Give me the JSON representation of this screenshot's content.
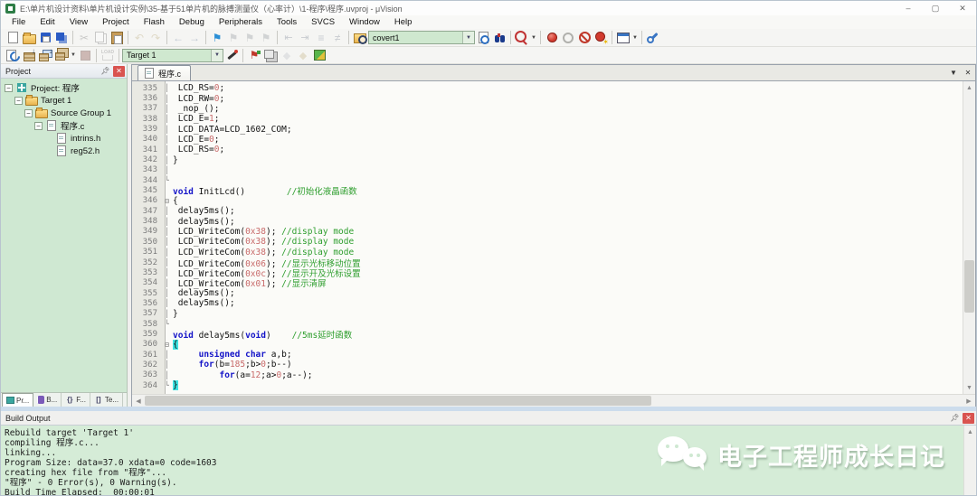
{
  "window": {
    "title": "E:\\单片机设计资料\\单片机设计实例\\35-基于51单片机的脉搏测量仪（心率计）\\1-程序\\程序.uvproj - μVision",
    "controls": [
      {
        "name": "minimize",
        "glyph": "–"
      },
      {
        "name": "maximize",
        "glyph": "▢"
      },
      {
        "name": "close",
        "glyph": "✕"
      }
    ]
  },
  "menu": {
    "items": [
      "File",
      "Edit",
      "View",
      "Project",
      "Flash",
      "Debug",
      "Peripherals",
      "Tools",
      "SVCS",
      "Window",
      "Help"
    ]
  },
  "toolbar1": {
    "search_value": "covert1",
    "icons": [
      {
        "t": "i",
        "n": "new-file-icon",
        "c": "i-page"
      },
      {
        "t": "i",
        "n": "open-file-icon",
        "c": "i-folder"
      },
      {
        "t": "i",
        "n": "save-icon",
        "c": "i-save"
      },
      {
        "t": "i",
        "n": "save-all-icon",
        "c": "i-saveall"
      },
      {
        "t": "s"
      },
      {
        "t": "i",
        "n": "cut-icon",
        "c": "i-cut",
        "g": 1
      },
      {
        "t": "i",
        "n": "copy-icon",
        "c": "i-copy",
        "g": 1
      },
      {
        "t": "i",
        "n": "paste-icon",
        "c": "i-paste"
      },
      {
        "t": "s"
      },
      {
        "t": "i",
        "n": "undo-icon",
        "c": "i-undo",
        "g": 1
      },
      {
        "t": "i",
        "n": "redo-icon",
        "c": "i-redo",
        "g": 1
      },
      {
        "t": "s"
      },
      {
        "t": "i",
        "n": "navigate-back-icon",
        "c": "i-back",
        "g": 1
      },
      {
        "t": "i",
        "n": "navigate-forward-icon",
        "c": "i-fwd",
        "g": 1
      },
      {
        "t": "s"
      },
      {
        "t": "i",
        "n": "bookmark-toggle-icon",
        "c": "i-flag"
      },
      {
        "t": "i",
        "n": "bookmark-prev-icon",
        "c": "i-flagg",
        "g": 1
      },
      {
        "t": "i",
        "n": "bookmark-next-icon",
        "c": "i-flagg",
        "g": 1
      },
      {
        "t": "i",
        "n": "bookmark-clear-icon",
        "c": "i-flagg",
        "g": 1
      },
      {
        "t": "s"
      },
      {
        "t": "i",
        "n": "unindent-icon",
        "c": "i-unind",
        "g": 1
      },
      {
        "t": "i",
        "n": "indent-icon",
        "c": "i-ind",
        "g": 1
      },
      {
        "t": "i",
        "n": "comment-icon",
        "c": "i-cmt",
        "g": 1
      },
      {
        "t": "i",
        "n": "uncomment-icon",
        "c": "i-ucmt",
        "g": 1
      },
      {
        "t": "s"
      },
      {
        "t": "i",
        "n": "find-in-files-icon",
        "c": "i-fif"
      },
      {
        "t": "combo",
        "n": "search-combobox",
        "bind": "toolbar1.search_value",
        "w": 118
      },
      {
        "t": "i",
        "n": "lookup-icon",
        "c": "i-lookup"
      },
      {
        "t": "i",
        "n": "find-icon",
        "c": "i-bino"
      },
      {
        "t": "s"
      },
      {
        "t": "i",
        "n": "run-to-cursor-icon",
        "c": "i-mag"
      },
      {
        "t": "caret"
      },
      {
        "t": "s"
      },
      {
        "t": "i",
        "n": "breakpoint-toggle-icon",
        "c": "i-dot"
      },
      {
        "t": "i",
        "n": "breakpoint-enable-icon",
        "c": "i-doto"
      },
      {
        "t": "i",
        "n": "breakpoint-disable-icon",
        "c": "i-dis"
      },
      {
        "t": "i",
        "n": "breakpoint-kill-all-icon",
        "c": "i-kill"
      },
      {
        "t": "s"
      },
      {
        "t": "i",
        "n": "debug-windows-icon",
        "c": "i-win"
      },
      {
        "t": "caret"
      },
      {
        "t": "s"
      },
      {
        "t": "i",
        "n": "configure-tools-icon",
        "c": "i-wrench"
      }
    ]
  },
  "toolbar2": {
    "target_value": "Target 1",
    "icons": [
      {
        "t": "i",
        "n": "translate-icon",
        "c": "i-trans"
      },
      {
        "t": "i",
        "n": "build-icon",
        "c": "i-build"
      },
      {
        "t": "i",
        "n": "rebuild-icon",
        "c": "i-rebuild"
      },
      {
        "t": "i",
        "n": "batch-build-icon",
        "c": "i-batch"
      },
      {
        "t": "caret"
      },
      {
        "t": "i",
        "n": "stop-build-icon",
        "c": "i-stop",
        "g": 1
      },
      {
        "t": "s"
      },
      {
        "t": "i",
        "n": "download-icon",
        "c": "i-load",
        "g": 1
      },
      {
        "t": "s"
      },
      {
        "t": "combo",
        "n": "target-combobox",
        "bind": "toolbar2.target_value",
        "w": 112
      },
      {
        "t": "i",
        "n": "options-for-target-icon",
        "c": "i-wand"
      },
      {
        "t": "s"
      },
      {
        "t": "i",
        "n": "file-extensions-icon",
        "c": "i-flag2"
      },
      {
        "t": "i",
        "n": "manage-project-items-icon",
        "c": "i-layers"
      },
      {
        "t": "i",
        "n": "multi-project-icon",
        "c": "i-diam",
        "g": 1
      },
      {
        "t": "i",
        "n": "project-workspace-icon",
        "c": "i-diam2",
        "g": 1
      },
      {
        "t": "i",
        "n": "manage-books-icon",
        "c": "i-pkg"
      }
    ]
  },
  "project_panel": {
    "title": "Project",
    "tree": [
      {
        "label": "Project: 程序",
        "depth": 0,
        "icon": "t-proj",
        "exp": "−"
      },
      {
        "label": "Target 1",
        "depth": 1,
        "icon": "t-folder",
        "exp": "−"
      },
      {
        "label": "Source Group 1",
        "depth": 2,
        "icon": "t-folder",
        "exp": "−"
      },
      {
        "label": "程序.c",
        "depth": 3,
        "icon": "t-file",
        "exp": "−"
      },
      {
        "label": "intrins.h",
        "depth": 4,
        "icon": "t-file",
        "exp": ""
      },
      {
        "label": "reg52.h",
        "depth": 4,
        "icon": "t-file",
        "exp": ""
      }
    ],
    "tabs": [
      {
        "label": "Pr...",
        "icon": "pt-proj",
        "glyph": "",
        "active": true
      },
      {
        "label": "B...",
        "icon": "pt-book",
        "glyph": "",
        "active": false
      },
      {
        "label": "F...",
        "icon": "pt-func",
        "glyph": "{}",
        "active": false
      },
      {
        "label": "Te...",
        "icon": "pt-tmpl",
        "glyph": "[]",
        "active": false
      }
    ]
  },
  "editor": {
    "tab": "程序.c",
    "tab_buttons": [
      {
        "name": "tab-list-dropdown",
        "glyph": "▼"
      },
      {
        "name": "close-document",
        "glyph": "✕"
      }
    ],
    "code": {
      "lines": [
        {
          "n": 335,
          "f": "m",
          "s": [
            [
              "p",
              " LCD_RS="
            ],
            [
              "n",
              "0"
            ],
            [
              "p",
              ";"
            ]
          ]
        },
        {
          "n": 336,
          "f": "m",
          "s": [
            [
              "p",
              " LCD_RW="
            ],
            [
              "n",
              "0"
            ],
            [
              "p",
              ";"
            ]
          ]
        },
        {
          "n": 337,
          "f": "m",
          "s": [
            [
              "p",
              " _nop_();"
            ]
          ]
        },
        {
          "n": 338,
          "f": "m",
          "s": [
            [
              "p",
              " LCD_E="
            ],
            [
              "n",
              "1"
            ],
            [
              "p",
              ";"
            ]
          ]
        },
        {
          "n": 339,
          "f": "m",
          "s": [
            [
              "p",
              " LCD_DATA=LCD_1602_COM;"
            ]
          ]
        },
        {
          "n": 340,
          "f": "m",
          "s": [
            [
              "p",
              " LCD_E="
            ],
            [
              "n",
              "0"
            ],
            [
              "p",
              ";"
            ]
          ]
        },
        {
          "n": 341,
          "f": "m",
          "s": [
            [
              "p",
              " LCD_RS="
            ],
            [
              "n",
              "0"
            ],
            [
              "p",
              ";"
            ]
          ]
        },
        {
          "n": 342,
          "f": "m",
          "s": [
            [
              "p",
              "}"
            ]
          ]
        },
        {
          "n": 343,
          "f": "m",
          "s": []
        },
        {
          "n": 344,
          "f": "e",
          "s": []
        },
        {
          "n": 345,
          "f": "",
          "s": [
            [
              "k",
              "void"
            ],
            [
              "p",
              " InitLcd()        "
            ],
            [
              "c",
              "//初始化液晶函数"
            ]
          ]
        },
        {
          "n": 346,
          "f": "s",
          "s": [
            [
              "p",
              "{"
            ]
          ]
        },
        {
          "n": 347,
          "f": "m",
          "s": [
            [
              "p",
              " delay5ms();"
            ]
          ]
        },
        {
          "n": 348,
          "f": "m",
          "s": [
            [
              "p",
              " delay5ms();"
            ]
          ]
        },
        {
          "n": 349,
          "f": "m",
          "s": [
            [
              "p",
              " LCD_WriteCom("
            ],
            [
              "n",
              "0x38"
            ],
            [
              "p",
              "); "
            ],
            [
              "c",
              "//display mode"
            ]
          ]
        },
        {
          "n": 350,
          "f": "m",
          "s": [
            [
              "p",
              " LCD_WriteCom("
            ],
            [
              "n",
              "0x38"
            ],
            [
              "p",
              "); "
            ],
            [
              "c",
              "//display mode"
            ]
          ]
        },
        {
          "n": 351,
          "f": "m",
          "s": [
            [
              "p",
              " LCD_WriteCom("
            ],
            [
              "n",
              "0x38"
            ],
            [
              "p",
              "); "
            ],
            [
              "c",
              "//display mode"
            ]
          ]
        },
        {
          "n": 352,
          "f": "m",
          "s": [
            [
              "p",
              " LCD_WriteCom("
            ],
            [
              "n",
              "0x06"
            ],
            [
              "p",
              "); "
            ],
            [
              "c",
              "//显示光标移动位置"
            ]
          ]
        },
        {
          "n": 353,
          "f": "m",
          "s": [
            [
              "p",
              " LCD_WriteCom("
            ],
            [
              "n",
              "0x0c"
            ],
            [
              "p",
              "); "
            ],
            [
              "c",
              "//显示开及光标设置"
            ]
          ]
        },
        {
          "n": 354,
          "f": "m",
          "s": [
            [
              "p",
              " LCD_WriteCom("
            ],
            [
              "n",
              "0x01"
            ],
            [
              "p",
              "); "
            ],
            [
              "c",
              "//显示清屏"
            ]
          ]
        },
        {
          "n": 355,
          "f": "m",
          "s": [
            [
              "p",
              " delay5ms();"
            ]
          ]
        },
        {
          "n": 356,
          "f": "m",
          "s": [
            [
              "p",
              " delay5ms();"
            ]
          ]
        },
        {
          "n": 357,
          "f": "m",
          "s": [
            [
              "p",
              "}"
            ]
          ]
        },
        {
          "n": 358,
          "f": "e",
          "s": []
        },
        {
          "n": 359,
          "f": "",
          "s": [
            [
              "k",
              "void"
            ],
            [
              "p",
              " delay5ms("
            ],
            [
              "k",
              "void"
            ],
            [
              "p",
              ")    "
            ],
            [
              "c",
              "//5ms延时函数"
            ]
          ]
        },
        {
          "n": 360,
          "f": "s",
          "s": [
            [
              "h",
              "{"
            ]
          ]
        },
        {
          "n": 361,
          "f": "m",
          "s": [
            [
              "p",
              "     "
            ],
            [
              "k",
              "unsigned"
            ],
            [
              "p",
              " "
            ],
            [
              "k",
              "char"
            ],
            [
              "p",
              " a,b;"
            ]
          ]
        },
        {
          "n": 362,
          "f": "m",
          "s": [
            [
              "p",
              "     "
            ],
            [
              "k",
              "for"
            ],
            [
              "p",
              "(b="
            ],
            [
              "n",
              "185"
            ],
            [
              "p",
              ";b>"
            ],
            [
              "n",
              "0"
            ],
            [
              "p",
              ";b--)"
            ]
          ]
        },
        {
          "n": 363,
          "f": "m",
          "s": [
            [
              "p",
              "         "
            ],
            [
              "k",
              "for"
            ],
            [
              "p",
              "(a="
            ],
            [
              "n",
              "12"
            ],
            [
              "p",
              ";a>"
            ],
            [
              "n",
              "0"
            ],
            [
              "p",
              ";a--);"
            ]
          ]
        },
        {
          "n": 364,
          "f": "e",
          "s": [
            [
              "h",
              "}"
            ]
          ]
        }
      ]
    }
  },
  "build_output": {
    "title": "Build Output",
    "lines": [
      "Rebuild target 'Target 1'",
      "compiling 程序.c...",
      "linking...",
      "Program Size: data=37.0 xdata=0 code=1603",
      "creating hex file from \"程序\"...",
      "\"程序\" - 0 Error(s), 0 Warning(s).",
      "Build Time Elapsed:  00:00:01"
    ]
  },
  "watermark": {
    "text": "电子工程师成长日记",
    "icon": "wechat-icon"
  },
  "colors": {
    "panel_green": "#cfe8d2",
    "build_green": "#d5ecd7",
    "combo_green": "#cfe8cf",
    "keyword": "#1414c8",
    "comment": "#2e9e2e",
    "number": "#c86a6a",
    "brace_highlight": "#3fe3e3"
  }
}
